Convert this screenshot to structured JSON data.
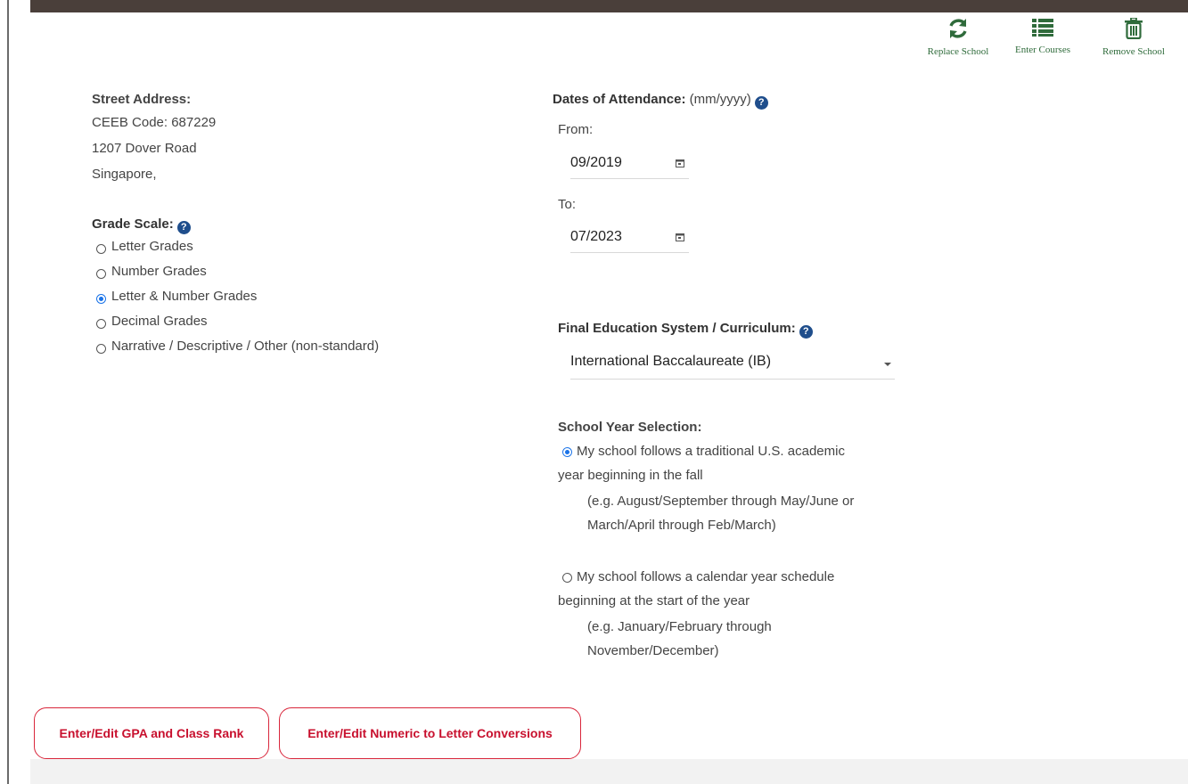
{
  "actions": {
    "replace": "Replace School",
    "enter_courses": "Enter Courses",
    "remove": "Remove School"
  },
  "address": {
    "heading": "Street Address:",
    "ceeb": "CEEB Code: 687229",
    "street": "1207 Dover Road",
    "city": "Singapore,"
  },
  "grade_scale": {
    "heading": "Grade Scale:",
    "options": [
      {
        "label": "Letter Grades",
        "selected": false
      },
      {
        "label": "Number Grades",
        "selected": false
      },
      {
        "label": "Letter & Number Grades",
        "selected": true
      },
      {
        "label": "Decimal Grades",
        "selected": false
      },
      {
        "label": "Narrative / Descriptive / Other (non-standard)",
        "selected": false
      }
    ]
  },
  "dates": {
    "heading": "Dates of Attendance:",
    "format_hint": "(mm/yyyy)",
    "from_label": "From:",
    "from_value": "09/2019",
    "to_label": "To:",
    "to_value": "07/2023"
  },
  "curriculum": {
    "heading": "Final Education System / Curriculum:",
    "selected": "International Baccalaureate (IB)"
  },
  "school_year": {
    "heading": "School Year Selection:",
    "opt1_line1": "My school follows a traditional U.S. academic",
    "opt1_line2": "year beginning in the fall",
    "opt1_ex1": "(e.g. August/September through May/June or",
    "opt1_ex2": "March/April through Feb/March)",
    "opt1_selected": true,
    "opt2_line1": "My school follows a calendar year schedule",
    "opt2_line2": "beginning at the start of the year",
    "opt2_ex1": "(e.g. January/February through",
    "opt2_ex2": "November/December)",
    "opt2_selected": false
  },
  "buttons": {
    "gpa": "Enter/Edit GPA and Class Rank",
    "conversions": "Enter/Edit Numeric to Letter Conversions"
  },
  "colors": {
    "accent_green": "#2f6b3b",
    "help_blue": "#1f4e8c",
    "radio_blue": "#1a73e8",
    "button_red": "#c8102e"
  }
}
